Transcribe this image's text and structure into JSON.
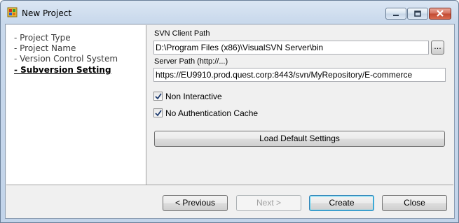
{
  "window": {
    "title": "New Project"
  },
  "steps": [
    {
      "label": "- Project Type",
      "active": false
    },
    {
      "label": "- Project Name",
      "active": false
    },
    {
      "label": "- Version Control System",
      "active": false
    },
    {
      "label": "- Subversion Setting",
      "active": true
    }
  ],
  "form": {
    "svn_client_path_label": "SVN Client Path",
    "svn_client_path_value": "D:\\Program Files (x86)\\VisualSVN Server\\bin",
    "browse_label": "...",
    "server_path_label": "Server Path (http://...)",
    "server_path_value": "https://EU9910.prod.quest.corp:8443/svn/MyRepository/E-commerce",
    "non_interactive_label": "Non Interactive",
    "non_interactive_checked": true,
    "no_auth_cache_label": "No Authentication Cache",
    "no_auth_cache_checked": true,
    "load_defaults_label": "Load Default Settings"
  },
  "buttons": {
    "previous": "< Previous",
    "next": "Next >",
    "create": "Create",
    "close": "Close"
  }
}
